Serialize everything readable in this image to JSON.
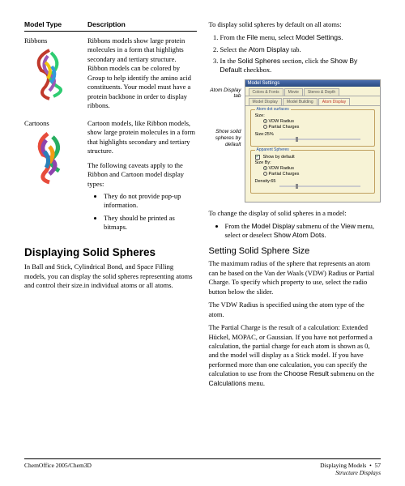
{
  "left": {
    "header_a": "Model Type",
    "header_b": "Description",
    "entries": [
      {
        "label": "Ribbons",
        "text": "Ribbons models show large protein molecules in a form that highlights secondary and tertiary structure. Ribbon models can be colored by Group to help identify the amino acid constituents. Your model must have a protein backbone in order to display ribbons."
      },
      {
        "label": "Cartoons",
        "text": "Cartoon models, like Ribbon models, show large protein molecules in a form that highlights secondary and tertiary structure."
      }
    ],
    "caveat_intro": "The following caveats apply to the Ribbon and Cartoon model display types:",
    "caveats": [
      "They do not provide pop-up information.",
      "They should be printed as bitmaps."
    ],
    "h2": "Displaying Solid Spheres",
    "p1": "In Ball and Stick, Cylindrical Bond, and Space Filling models, you can display the solid spheres representing atoms and control their size.in individual atoms or all atoms."
  },
  "right": {
    "intro": "To display solid spheres by default on all atoms:",
    "steps": [
      "From the File menu, select Model Settings.",
      "Select the Atom Display tab.",
      "In the Solid Spheres section, click the Show By Default checkbox."
    ],
    "step1_bold": [
      "File",
      "Model Settings"
    ],
    "step2_bold": [
      "Atom Display"
    ],
    "step3_bold": [
      "Solid Spheres",
      "Show By Default"
    ],
    "labels": {
      "atom_display": "Atom Display tab",
      "show_solid": "Show solid spheres by default"
    },
    "dialog": {
      "title": "Model Settings",
      "tabs_row1": [
        "Colors & Fonts",
        "Movie",
        "Stereo & Depth"
      ],
      "tabs_row2": [
        "Model Display",
        "Model Building",
        "Atom Display"
      ],
      "group1": "Atom dot surfaces",
      "g1_size": "Size:",
      "g1_r1": "VDW Radius",
      "g1_r2": "Partial Charges",
      "g1_sizepct": "Size:25%",
      "group2": "Apparent Spheres",
      "g2_chk": "Show by default",
      "g2_size": "Size By:",
      "g2_r1": "VDW Radius",
      "g2_r2": "Partial Charges",
      "g2_density": "Density:65"
    },
    "change_intro": "To change the display of solid spheres in a model:",
    "change_bullet": "From the Model Display submenu of the View menu, select or deselect Show Atom Dots.",
    "change_bold": [
      "Model Display",
      "View",
      "Show Atom Dots"
    ],
    "h3": "Setting Solid Sphere Size",
    "p1": "The maximum radius of the sphere that represents an atom can be based on the Van der Waals (VDW) Radius or Partial Charge. To specify which property to use, select the radio button below the slider.",
    "p2": "The VDW Radius is specified using the atom type of the atom.",
    "p3a": "The Partial Charge is the result of a calculation: Extended Hückel, MOPAC, or Gaussian. If you have not performed a calculation, the partial charge for each atom is shown as 0, and the model will display as a Stick model. If you have performed more than one calculation, you can specify the calculation to use from the ",
    "p3b": "Choose Result",
    "p3c": " submenu on the ",
    "p3d": "Calculations",
    "p3e": " menu."
  },
  "footer": {
    "left": "ChemOffice 2005/Chem3D",
    "right1": "Displaying Models",
    "page": "57",
    "right2": "Structure Displays"
  }
}
